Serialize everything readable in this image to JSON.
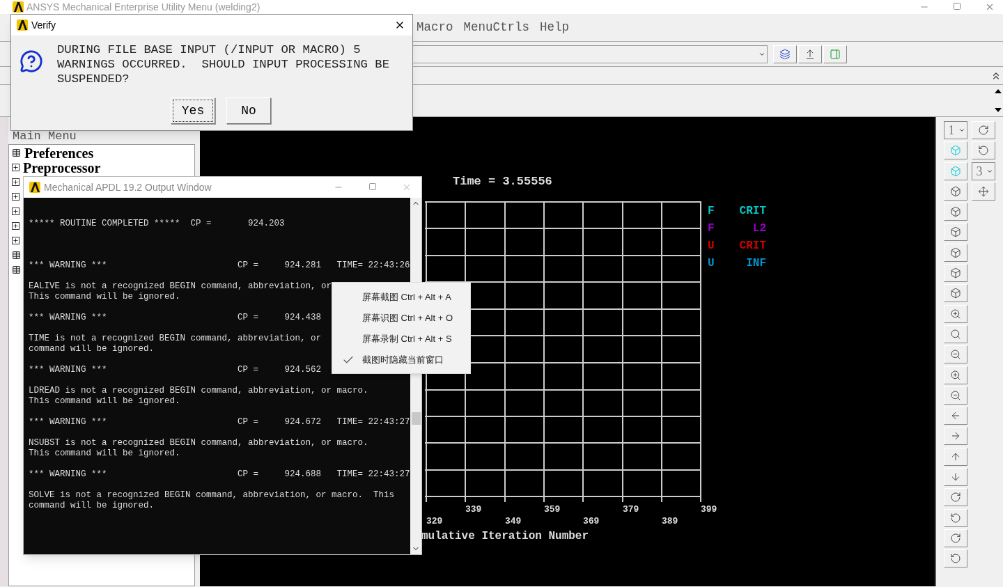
{
  "main_window": {
    "title": "ANSYS Mechanical Enterprise Utility Menu (welding2)",
    "menu": [
      "Macro",
      "MenuCtrls",
      "Help"
    ],
    "main_menu": {
      "title": "Main Menu",
      "items": [
        {
          "label": "Preferences",
          "kind": "leaf"
        },
        {
          "label": "Preprocessor",
          "kind": "folder",
          "expanded": false
        },
        {
          "kind": "folder",
          "expanded": false
        },
        {
          "kind": "folder",
          "expanded": false
        },
        {
          "kind": "folder",
          "expanded": false
        },
        {
          "kind": "folder",
          "expanded": false
        },
        {
          "kind": "folder",
          "expanded": false
        },
        {
          "kind": "leaf"
        },
        {
          "kind": "leaf"
        }
      ]
    },
    "graph": {
      "title": "Time = 3.55556",
      "x_tick_labels": [
        "329",
        "339",
        "349",
        "359",
        "369",
        "379",
        "389",
        "399"
      ],
      "x_axis_label": "mulative Iteration Number",
      "legend": [
        {
          "quantity": "F",
          "norm": "CRIT",
          "color": "#00c8c8"
        },
        {
          "quantity": "F",
          "norm": "L2",
          "color": "#9b00d2"
        },
        {
          "quantity": "U",
          "norm": "CRIT",
          "color": "#d20000"
        },
        {
          "quantity": "U",
          "norm": "INF",
          "color": "#0096d2"
        }
      ]
    },
    "right_toolbar": {
      "left_dropdown_value": "1",
      "right_dropdown_value": "3"
    }
  },
  "verify_dialog": {
    "title": "Verify",
    "message": "DURING FILE BASE INPUT (/INPUT OR MACRO) 5 WARNINGS OCCURRED.  SHOULD INPUT PROCESSING BE SUSPENDED?",
    "buttons": [
      {
        "label": "Yes",
        "focused": true
      },
      {
        "label": "No",
        "focused": false
      }
    ]
  },
  "output_window": {
    "title": "Mechanical APDL 19.2 Output Window",
    "blocks": [
      [
        "***** ROUTINE COMPLETED *****  CP =       924.203"
      ],
      [
        "*** WARNING ***                         CP =     924.281   TIME= 22:43:26"
      ],
      [
        "EALIVE is not a recognized BEGIN command, abbreviation, or",
        "This command will be ignored."
      ],
      [
        "*** WARNING ***                         CP =     924.438"
      ],
      [
        "TIME is not a recognized BEGIN command, abbreviation, or",
        "command will be ignored."
      ],
      [
        "*** WARNING ***                         CP =     924.562"
      ],
      [
        "LDREAD is not a recognized BEGIN command, abbreviation, or macro.",
        "This command will be ignored."
      ],
      [
        "*** WARNING ***                         CP =     924.672   TIME= 22:43:27"
      ],
      [
        "NSUBST is not a recognized BEGIN command, abbreviation, or macro.",
        "This command will be ignored."
      ],
      [
        "*** WARNING ***                         CP =     924.688   TIME= 22:43:27"
      ],
      [
        "SOLVE is not a recognized BEGIN command, abbreviation, or macro.  This",
        "command will be ignored."
      ]
    ]
  },
  "context_menu": {
    "items": [
      {
        "label": "屏幕截图 Ctrl + Alt + A",
        "checked": false
      },
      {
        "label": "屏幕识图 Ctrl + Alt + O",
        "checked": false
      },
      {
        "label": "屏幕录制 Ctrl + Alt + S",
        "checked": false
      },
      {
        "label": "截图时隐藏当前窗口",
        "checked": true
      }
    ]
  }
}
